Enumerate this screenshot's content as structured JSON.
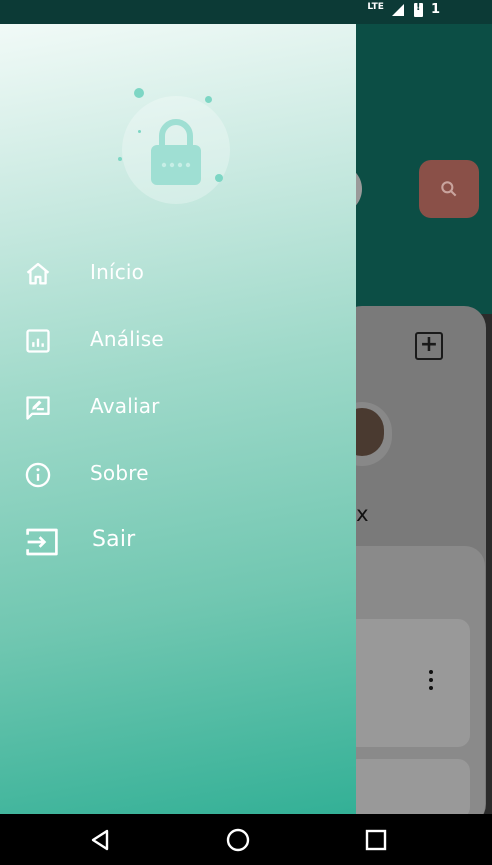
{
  "status_bar": {
    "network": "LTE",
    "notification_count": "1"
  },
  "drawer": {
    "items": [
      {
        "label": "Início",
        "icon": "home-icon"
      },
      {
        "label": "Análise",
        "icon": "analytics-icon"
      },
      {
        "label": "Avaliar",
        "icon": "rate-review-icon"
      },
      {
        "label": "Sobre",
        "icon": "info-icon"
      },
      {
        "label": "Sair",
        "icon": "logout-icon"
      }
    ]
  },
  "background_app": {
    "visible_name_fragment": "nax"
  },
  "colors": {
    "drawer_top": "#f1faf7",
    "drawer_bottom": "#33b096",
    "header_dimmed": "#0c4e45",
    "search_button_dimmed": "#8a5048"
  },
  "nav_bar": {
    "back": "back-icon",
    "home": "home-circle-icon",
    "recents": "recents-icon"
  }
}
